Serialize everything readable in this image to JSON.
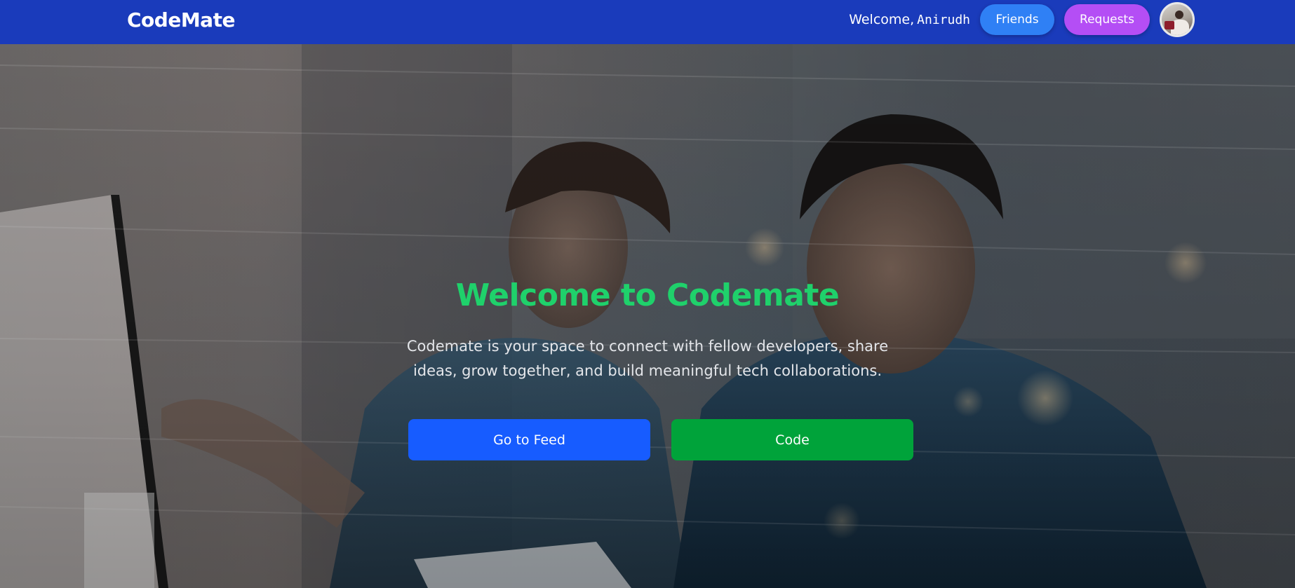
{
  "navbar": {
    "brand": "CodeMate",
    "welcome_prefix": "Welcome,",
    "username": "Anirudh",
    "friends_label": "Friends",
    "requests_label": "Requests",
    "avatar_icon": "user-avatar"
  },
  "hero": {
    "title": "Welcome to Codemate",
    "description": "Codemate is your space to connect with fellow developers, share ideas, grow together, and build meaningful tech collaborations.",
    "feed_button_label": "Go to Feed",
    "code_button_label": "Code"
  },
  "colors": {
    "navbar_bg": "#1a3bbb",
    "friends_button": "#2f80f5",
    "requests_button": "#b44ef5",
    "title_green": "#1fd16b",
    "feed_button": "#175cff",
    "code_button": "#00a33a"
  }
}
